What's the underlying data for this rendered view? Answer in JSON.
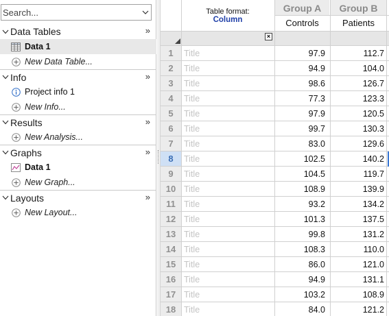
{
  "navigator": {
    "search_placeholder": "Search...",
    "sections": [
      {
        "title": "Data Tables",
        "more": "»",
        "items": [
          {
            "icon": "data-table-icon",
            "label": "Data 1",
            "style": "bold",
            "selected": true
          },
          {
            "icon": "add-circle-icon",
            "label": "New Data Table...",
            "style": "italic"
          }
        ]
      },
      {
        "title": "Info",
        "more": "»",
        "items": [
          {
            "icon": "info-icon",
            "label": "Project info 1",
            "style": "normal"
          },
          {
            "icon": "add-circle-icon",
            "label": "New Info...",
            "style": "italic"
          }
        ]
      },
      {
        "title": "Results",
        "more": "»",
        "items": [
          {
            "icon": "add-circle-icon",
            "label": "New Analysis...",
            "style": "italic"
          }
        ]
      },
      {
        "title": "Graphs",
        "more": "»",
        "items": [
          {
            "icon": "graph-icon",
            "label": "Data 1",
            "style": "bold"
          },
          {
            "icon": "add-circle-icon",
            "label": "New Graph...",
            "style": "italic"
          }
        ]
      },
      {
        "title": "Layouts",
        "more": "»",
        "items": [
          {
            "icon": "add-circle-icon",
            "label": "New Layout...",
            "style": "italic"
          }
        ]
      }
    ]
  },
  "sheet": {
    "format_label": "Table format:",
    "format_value": "Column",
    "close_glyph": "×",
    "groups": [
      {
        "header": "Group A",
        "column": "Controls"
      },
      {
        "header": "Group B",
        "column": "Patients"
      }
    ],
    "title_placeholder": "Title",
    "active_row": 8,
    "rows": [
      {
        "n": "1",
        "a": "97.9",
        "b": "112.7"
      },
      {
        "n": "2",
        "a": "94.9",
        "b": "104.0"
      },
      {
        "n": "3",
        "a": "98.6",
        "b": "126.7"
      },
      {
        "n": "4",
        "a": "77.3",
        "b": "123.3"
      },
      {
        "n": "5",
        "a": "97.9",
        "b": "120.5"
      },
      {
        "n": "6",
        "a": "99.7",
        "b": "130.3"
      },
      {
        "n": "7",
        "a": "83.0",
        "b": "129.6"
      },
      {
        "n": "8",
        "a": "102.5",
        "b": "140.2"
      },
      {
        "n": "9",
        "a": "104.5",
        "b": "119.7"
      },
      {
        "n": "10",
        "a": "108.9",
        "b": "139.9"
      },
      {
        "n": "11",
        "a": "93.2",
        "b": "134.2"
      },
      {
        "n": "12",
        "a": "101.3",
        "b": "137.5"
      },
      {
        "n": "13",
        "a": "99.8",
        "b": "131.2"
      },
      {
        "n": "14",
        "a": "108.3",
        "b": "110.0"
      },
      {
        "n": "15",
        "a": "86.0",
        "b": "121.0"
      },
      {
        "n": "16",
        "a": "94.9",
        "b": "131.1"
      },
      {
        "n": "17",
        "a": "103.2",
        "b": "108.9"
      },
      {
        "n": "18",
        "a": "84.0",
        "b": "121.2"
      }
    ]
  }
}
